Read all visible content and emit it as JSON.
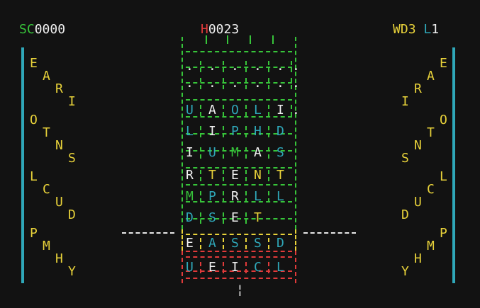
{
  "hud": {
    "score_label": "SC",
    "score_value": "0000",
    "hiscore_label": "H",
    "hiscore_value": "0023",
    "word_label": "WD",
    "word_value": "3",
    "level_label": "L",
    "level_value": "1"
  },
  "side_letters": [
    "E",
    "A",
    "R",
    "I",
    "O",
    "T",
    "N",
    "S",
    "L",
    "C",
    "U",
    "D",
    "P",
    "M",
    "H",
    "Y"
  ],
  "grid_rows": [
    [
      ".",
      ".",
      ".",
      ".",
      ".",
      "."
    ],
    [
      ".",
      ".",
      ".",
      ".",
      ".",
      "."
    ],
    [
      "U",
      "A",
      "O",
      "L",
      "I",
      "."
    ],
    [
      "L",
      "I",
      "P",
      "H",
      "D"
    ],
    [
      "I",
      "U",
      "M",
      "A",
      "S"
    ],
    [
      "R",
      "T",
      "E",
      "N",
      "T"
    ],
    [
      "M",
      "P",
      "R",
      "L",
      "L"
    ],
    [
      "D",
      "S",
      "E",
      "T"
    ],
    [
      "E",
      "A",
      "S",
      "S",
      "D"
    ],
    [
      "U",
      "E",
      "I",
      "C",
      "L"
    ]
  ],
  "colors": {
    "yellow": "#e8d23a",
    "green": "#37c43a",
    "red": "#e03a3a",
    "cyan": "#2fa7b8",
    "white": "#f0f0f0"
  }
}
